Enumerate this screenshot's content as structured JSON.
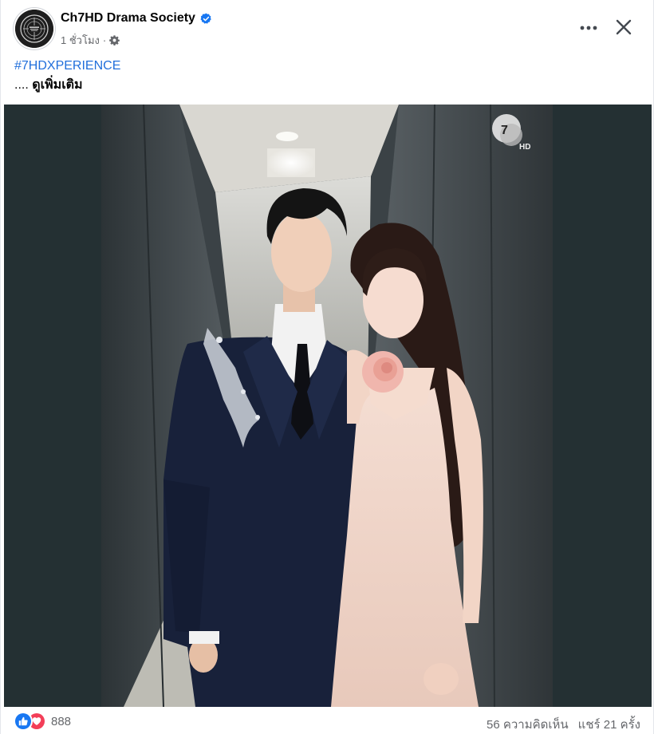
{
  "post": {
    "page_name": "Ch7HD Drama Society",
    "time_ago": "1 ชั่วโมง",
    "separator": "·",
    "hashtag": "#7HDXPERIENCE",
    "see_more_prefix": "....",
    "see_more_label": "ดูเพิ่มเติม"
  },
  "icons": {
    "verified": "verified-badge-icon",
    "privacy": "gear-icon",
    "more": "more-options-icon",
    "close": "close-icon",
    "like": "like-reaction-icon",
    "love": "love-reaction-icon"
  },
  "photo": {
    "watermark_text": "HD",
    "watermark_number": "7"
  },
  "footer": {
    "reaction_count": "888",
    "comments": "56 ความคิดเห็น",
    "shares": "แชร์ 21 ครั้ง"
  },
  "colors": {
    "hashtag": "#216fdb",
    "verified": "#1877f2",
    "like": "#1877f2",
    "love": "#f33e58",
    "secondary_text": "#65676b"
  }
}
